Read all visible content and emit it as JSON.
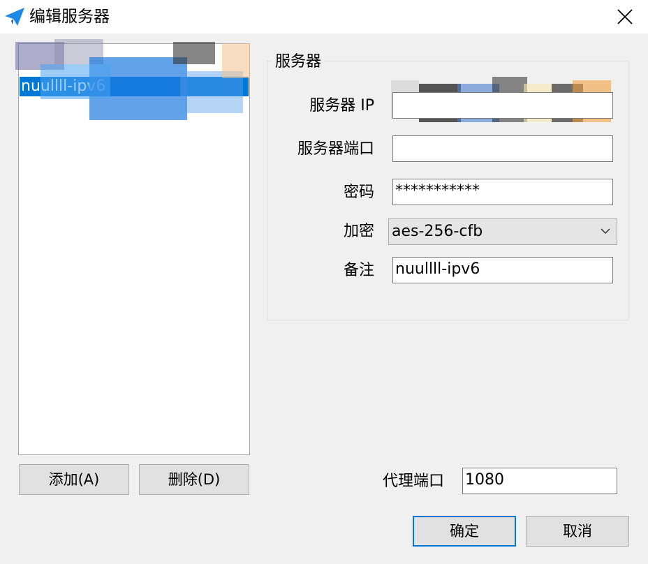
{
  "window": {
    "title": "编辑服务器"
  },
  "server_list": {
    "items": [
      {
        "label": "nuullll-ipv6"
      }
    ]
  },
  "buttons": {
    "add": "添加(A)",
    "delete": "删除(D)",
    "ok": "确定",
    "cancel": "取消"
  },
  "server_group": {
    "title": "服务器",
    "fields": {
      "ip_label": "服务器 IP",
      "ip_value": "",
      "port_label": "服务器端口",
      "port_value": "",
      "password_label": "密码",
      "password_value": "***********",
      "encryption_label": "加密",
      "encryption_value": "aes-256-cfb",
      "remark_label": "备注",
      "remark_value": "nuullll-ipv6"
    }
  },
  "proxy": {
    "port_label": "代理端口",
    "port_value": "1080"
  },
  "colors": {
    "selection": "#0078d7",
    "window_bg": "#f0f0f0",
    "accent_border": "#0078d7"
  },
  "icons": {
    "app": "paper-plane-icon",
    "close": "close-icon",
    "dropdown": "chevron-down-icon"
  }
}
